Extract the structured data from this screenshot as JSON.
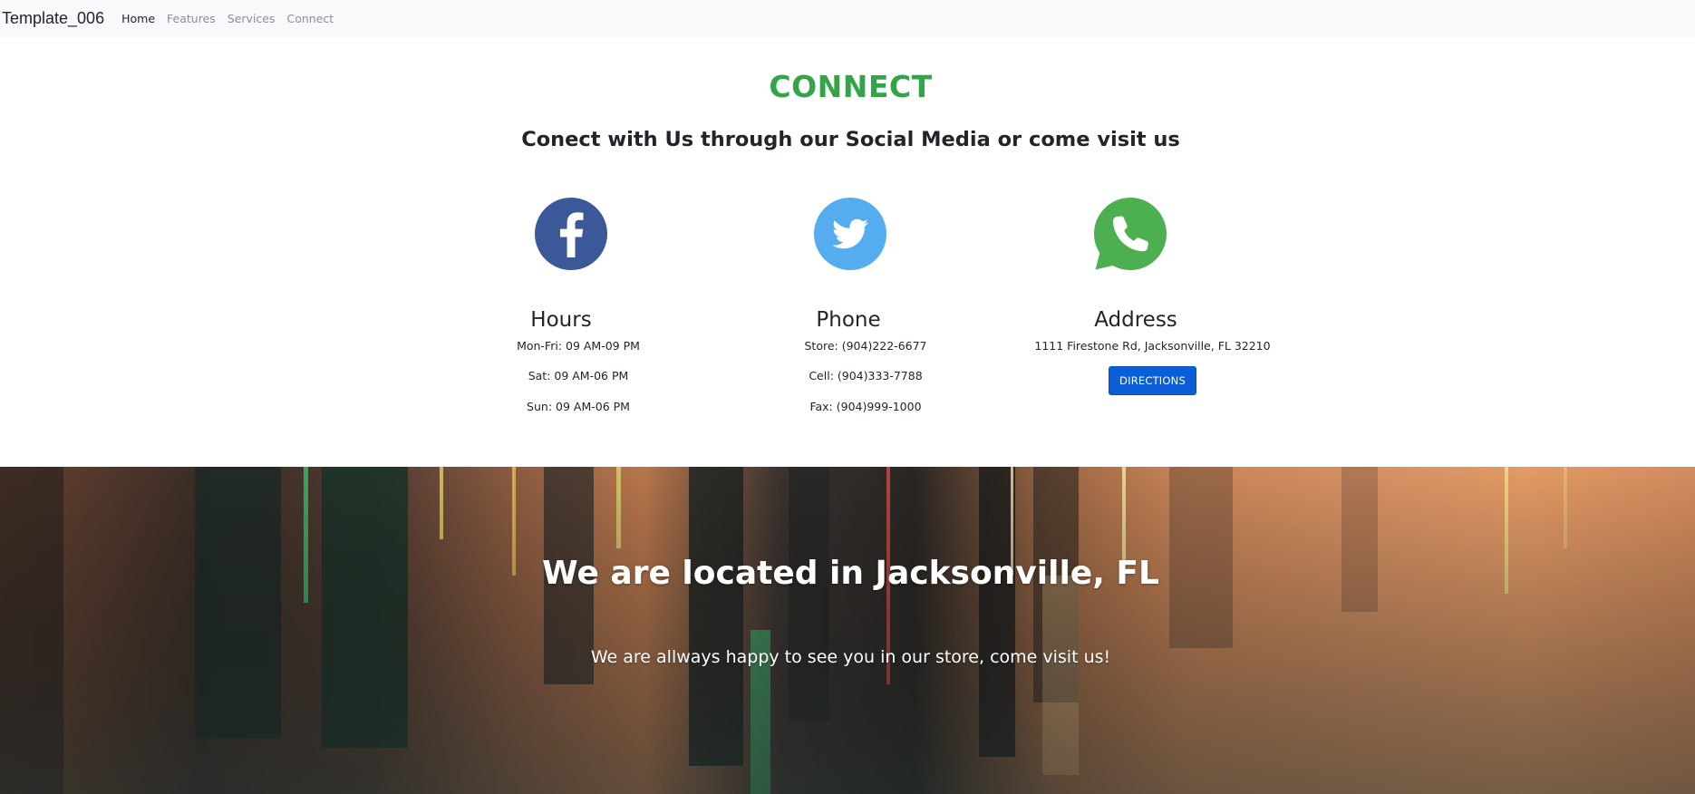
{
  "navbar": {
    "brand": "Template_006",
    "links": [
      {
        "label": "Home",
        "active": true
      },
      {
        "label": "Features",
        "active": false
      },
      {
        "label": "Services",
        "active": false
      },
      {
        "label": "Connect",
        "active": false
      }
    ]
  },
  "connect": {
    "title": "CONNECT",
    "subtitle": "Conect with Us through our Social Media or come visit us",
    "social": [
      {
        "icon": "facebook-icon",
        "color": "#3b5998"
      },
      {
        "icon": "twitter-icon",
        "color": "#55acee"
      },
      {
        "icon": "whatsapp-icon",
        "color": "#4caf50"
      }
    ],
    "hours": {
      "heading": "Hours",
      "lines": [
        "Mon-Fri: 09 AM-09 PM",
        "Sat: 09 AM-06 PM",
        "Sun: 09 AM-06 PM"
      ]
    },
    "phone": {
      "heading": "Phone",
      "lines": [
        "Store: (904)222-6677",
        "Cell: (904)333-7788",
        "Fax: (904)999-1000"
      ]
    },
    "address": {
      "heading": "Address",
      "line": "1111 Firestone Rd, Jacksonville, FL 32210",
      "button_label": "DIRECTIONS"
    },
    "accent_color": "#33a548",
    "button_color": "#0b5ed7"
  },
  "hero": {
    "title": "We are located in Jacksonville, FL",
    "text": "We are allways happy to see you in our store, come visit us!"
  }
}
